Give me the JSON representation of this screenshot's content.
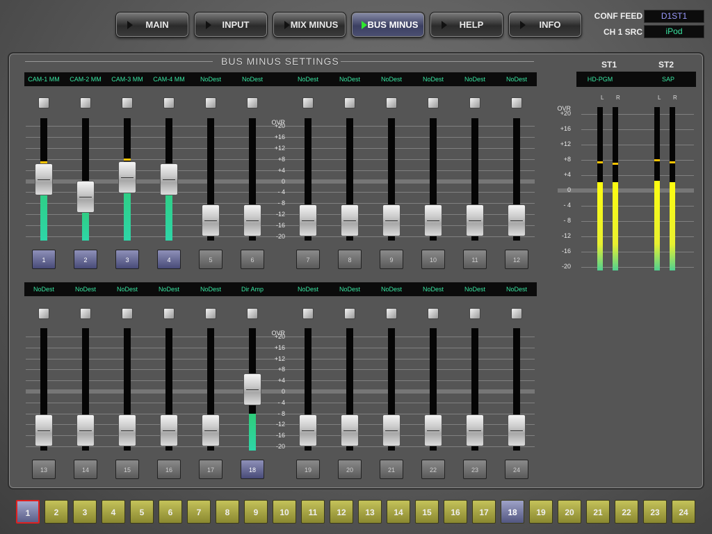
{
  "nav": {
    "tabs": [
      {
        "label": "MAIN",
        "active": false
      },
      {
        "label": "INPUT",
        "active": false
      },
      {
        "label": "MIX MINUS",
        "active": false
      },
      {
        "label": "BUS MINUS",
        "active": true
      },
      {
        "label": "HELP",
        "active": false
      },
      {
        "label": "INFO",
        "active": false
      }
    ]
  },
  "conf": {
    "feed_label": "CONF FEED",
    "feed_value": "D1ST1",
    "feed_color": "#9b9bff",
    "src_label": "CH 1 SRC",
    "src_value": "iPod",
    "src_color": "#39e6a2"
  },
  "panel": {
    "title": "BUS MINUS SETTINGS"
  },
  "scale": [
    "OVR",
    "+20",
    "+16",
    "+12",
    "+8",
    "+4",
    "0",
    "- 4",
    "- 8",
    "-12",
    "-16",
    "-20"
  ],
  "rows": [
    {
      "channels": [
        {
          "num": "1",
          "name": "CAM-1 MM",
          "selected": true,
          "level": 0.53,
          "meter": 0.51,
          "peak": 0.65,
          "peak_color": "#ffc400"
        },
        {
          "num": "2",
          "name": "CAM-2 MM",
          "selected": true,
          "level": 0.31,
          "meter": 0.29,
          "peak": 0.43,
          "peak_color": "#40e070"
        },
        {
          "num": "3",
          "name": "CAM-3 MM",
          "selected": true,
          "level": 0.56,
          "meter": 0.53,
          "peak": 0.67,
          "peak_color": "#ffc400"
        },
        {
          "num": "4",
          "name": "CAM-4 MM",
          "selected": true,
          "level": 0.53,
          "meter": 0.51,
          "peak": 0.63,
          "peak_color": "#ffc400"
        },
        {
          "num": "5",
          "name": "NoDest",
          "selected": false,
          "level": 0.0,
          "meter": 0,
          "peak": null
        },
        {
          "num": "6",
          "name": "NoDest",
          "selected": false,
          "level": 0.0,
          "meter": 0,
          "peak": null
        },
        {
          "num": "7",
          "name": "NoDest",
          "selected": false,
          "level": 0.0,
          "meter": 0,
          "peak": null
        },
        {
          "num": "8",
          "name": "NoDest",
          "selected": false,
          "level": 0.0,
          "meter": 0,
          "peak": null
        },
        {
          "num": "9",
          "name": "NoDest",
          "selected": false,
          "level": 0.0,
          "meter": 0,
          "peak": null
        },
        {
          "num": "10",
          "name": "NoDest",
          "selected": false,
          "level": 0.0,
          "meter": 0,
          "peak": null
        },
        {
          "num": "11",
          "name": "NoDest",
          "selected": false,
          "level": 0.0,
          "meter": 0,
          "peak": null
        },
        {
          "num": "12",
          "name": "NoDest",
          "selected": false,
          "level": 0.0,
          "meter": 0,
          "peak": null
        }
      ]
    },
    {
      "channels": [
        {
          "num": "13",
          "name": "NoDest",
          "selected": false,
          "level": 0.0,
          "meter": 0,
          "peak": null
        },
        {
          "num": "14",
          "name": "NoDest",
          "selected": false,
          "level": 0.0,
          "meter": 0,
          "peak": null
        },
        {
          "num": "15",
          "name": "NoDest",
          "selected": false,
          "level": 0.0,
          "meter": 0,
          "peak": null
        },
        {
          "num": "16",
          "name": "NoDest",
          "selected": false,
          "level": 0.0,
          "meter": 0,
          "peak": null
        },
        {
          "num": "17",
          "name": "NoDest",
          "selected": false,
          "level": 0.0,
          "meter": 0,
          "peak": null
        },
        {
          "num": "18",
          "name": "Dir Amp",
          "selected": true,
          "level": 0.53,
          "meter": 0.3,
          "peak": 0.44,
          "peak_color": "#40e070"
        },
        {
          "num": "19",
          "name": "NoDest",
          "selected": false,
          "level": 0.0,
          "meter": 0,
          "peak": null
        },
        {
          "num": "20",
          "name": "NoDest",
          "selected": false,
          "level": 0.0,
          "meter": 0,
          "peak": null
        },
        {
          "num": "21",
          "name": "NoDest",
          "selected": false,
          "level": 0.0,
          "meter": 0,
          "peak": null
        },
        {
          "num": "22",
          "name": "NoDest",
          "selected": false,
          "level": 0.0,
          "meter": 0,
          "peak": null
        },
        {
          "num": "23",
          "name": "NoDest",
          "selected": false,
          "level": 0.0,
          "meter": 0,
          "peak": null
        },
        {
          "num": "24",
          "name": "NoDest",
          "selected": false,
          "level": 0.0,
          "meter": 0,
          "peak": null
        }
      ]
    }
  ],
  "st": {
    "buses": [
      {
        "title": "ST1",
        "dest": "HD-PGM",
        "l_label": "L",
        "r_label": "R",
        "l": 0.54,
        "r": 0.54,
        "l_peak": 0.67,
        "r_peak": 0.66
      },
      {
        "title": "ST2",
        "dest": "SAP",
        "l_label": "L",
        "r_label": "R",
        "l": 0.55,
        "r": 0.54,
        "l_peak": 0.68,
        "r_peak": 0.67
      }
    ]
  },
  "bottom": {
    "buttons": [
      {
        "label": "1",
        "state": "cur"
      },
      {
        "label": "2",
        "state": ""
      },
      {
        "label": "3",
        "state": ""
      },
      {
        "label": "4",
        "state": ""
      },
      {
        "label": "5",
        "state": ""
      },
      {
        "label": "6",
        "state": ""
      },
      {
        "label": "7",
        "state": ""
      },
      {
        "label": "8",
        "state": ""
      },
      {
        "label": "9",
        "state": ""
      },
      {
        "label": "10",
        "state": ""
      },
      {
        "label": "11",
        "state": ""
      },
      {
        "label": "12",
        "state": ""
      },
      {
        "label": "13",
        "state": ""
      },
      {
        "label": "14",
        "state": ""
      },
      {
        "label": "15",
        "state": ""
      },
      {
        "label": "16",
        "state": ""
      },
      {
        "label": "17",
        "state": ""
      },
      {
        "label": "18",
        "state": "sel"
      },
      {
        "label": "19",
        "state": ""
      },
      {
        "label": "20",
        "state": ""
      },
      {
        "label": "21",
        "state": ""
      },
      {
        "label": "22",
        "state": ""
      },
      {
        "label": "23",
        "state": ""
      },
      {
        "label": "24",
        "state": ""
      }
    ]
  }
}
